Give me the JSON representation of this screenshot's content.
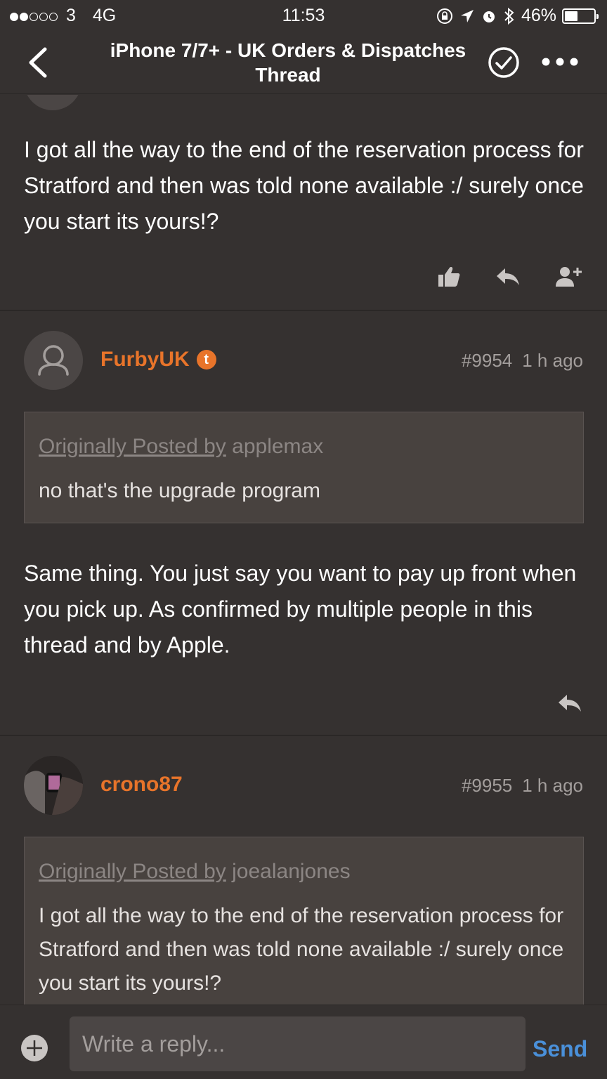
{
  "status": {
    "signal_strength": 2,
    "carrier": "3",
    "network": "4G",
    "time": "11:53",
    "battery_text": "46%",
    "battery_level": 0.46
  },
  "nav": {
    "title": "iPhone 7/7+ - UK Orders & Dispatches Thread"
  },
  "posts": [
    {
      "body": "I got all the way to the end of the reservation process for Stratford and then was told none available :/ surely once you start its yours!?"
    },
    {
      "username": "FurbyUK",
      "badge": "t",
      "number": "#9954",
      "time": "1 h ago",
      "quote": {
        "prefix": "Originally Posted by",
        "author": "applemax",
        "text": "no that's the upgrade program"
      },
      "body": "Same thing. You just say you want to pay up front when you pick up. As confirmed by multiple people in this thread and by Apple."
    },
    {
      "username": "crono87",
      "number": "#9955",
      "time": "1 h ago",
      "quote": {
        "prefix": "Originally Posted by",
        "author": "joealanjones",
        "text": "I got all the way to the end of the reservation process for Stratford and then was told none available :/ surely once you start its yours!?"
      }
    }
  ],
  "composer": {
    "placeholder": "Write a reply...",
    "send_label": "Send"
  }
}
